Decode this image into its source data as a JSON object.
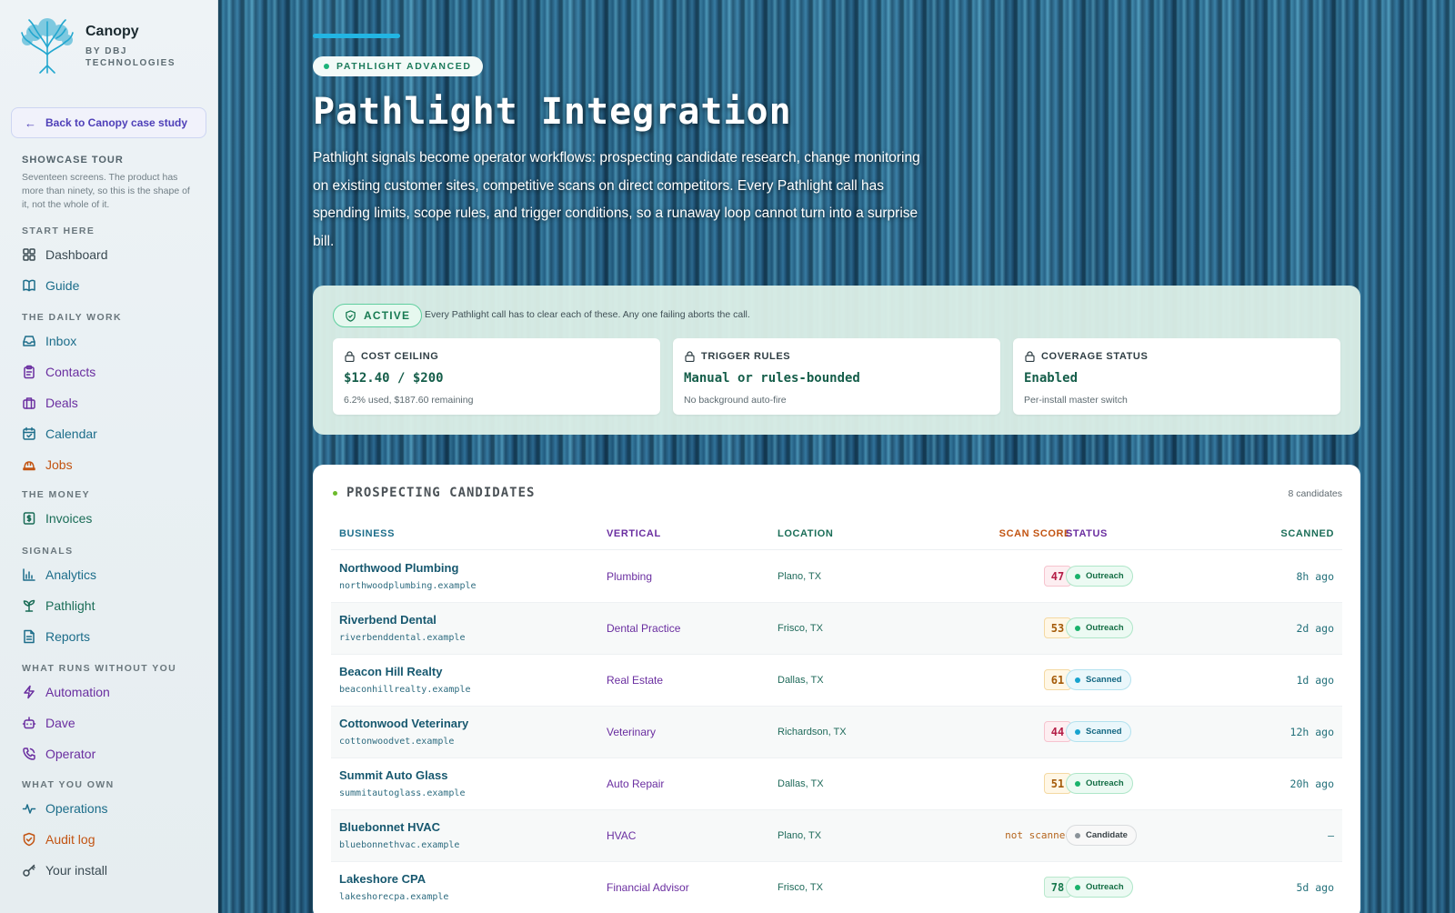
{
  "brand": {
    "name": "Canopy",
    "sub": "BY DBJ TECHNOLOGIES"
  },
  "sidebar": {
    "back_label": "Back to Canopy case study",
    "tour_title": "SHOWCASE TOUR",
    "tour_desc": "Seventeen screens. The product has more than ninety, so this is the shape of it, not the whole of it.",
    "sections": [
      {
        "title": "START HERE",
        "items": [
          {
            "label": "Dashboard",
            "icon": "grid-icon",
            "color": "#3a4a52"
          },
          {
            "label": "Guide",
            "icon": "book-icon",
            "color": "#1c6d8a"
          }
        ]
      },
      {
        "title": "THE DAILY WORK",
        "items": [
          {
            "label": "Inbox",
            "icon": "inbox-icon",
            "color": "#1c6d8a"
          },
          {
            "label": "Contacts",
            "icon": "clipboard-icon",
            "color": "#6a2ea0"
          },
          {
            "label": "Deals",
            "icon": "briefcase-icon",
            "color": "#6a2ea0"
          },
          {
            "label": "Calendar",
            "icon": "calendar-icon",
            "color": "#1c6d8a"
          },
          {
            "label": "Jobs",
            "icon": "hardhat-icon",
            "color": "#c25412"
          }
        ]
      },
      {
        "title": "THE MONEY",
        "items": [
          {
            "label": "Invoices",
            "icon": "invoice-icon",
            "color": "#1a6d57"
          }
        ]
      },
      {
        "title": "SIGNALS",
        "items": [
          {
            "label": "Analytics",
            "icon": "bar-chart-icon",
            "color": "#1c6d8a"
          },
          {
            "label": "Pathlight",
            "icon": "sprout-icon",
            "color": "#1a6d57"
          },
          {
            "label": "Reports",
            "icon": "document-icon",
            "color": "#1c6d8a"
          }
        ]
      },
      {
        "title": "WHAT RUNS WITHOUT YOU",
        "items": [
          {
            "label": "Automation",
            "icon": "bolt-icon",
            "color": "#6a2ea0"
          },
          {
            "label": "Dave",
            "icon": "robot-icon",
            "color": "#6a2ea0"
          },
          {
            "label": "Operator",
            "icon": "phone-icon",
            "color": "#6a2ea0"
          }
        ]
      },
      {
        "title": "WHAT YOU OWN",
        "items": [
          {
            "label": "Operations",
            "icon": "pulse-icon",
            "color": "#1c6d8a"
          },
          {
            "label": "Audit log",
            "icon": "shield-icon",
            "color": "#c25412"
          },
          {
            "label": "Your install",
            "icon": "key-icon",
            "color": "#3a4a52"
          }
        ]
      }
    ]
  },
  "hero": {
    "pill": "PATHLIGHT ADVANCED",
    "title": "Pathlight Integration",
    "description": "Pathlight signals become operator workflows: prospecting candidate research, change monitoring on existing customer sites, competitive scans on direct competitors. Every Pathlight call has spending limits, scope rules, and trigger conditions, so a runaway loop cannot turn into a surprise bill."
  },
  "guard": {
    "status": "ACTIVE",
    "note": "Every Pathlight call has to clear each of these. Any one failing aborts the call.",
    "cards": [
      {
        "label": "COST CEILING",
        "value": "$12.40 / $200",
        "sub": "6.2% used, $187.60 remaining"
      },
      {
        "label": "TRIGGER RULES",
        "value": "Manual or rules-bounded",
        "sub": "No background auto-fire"
      },
      {
        "label": "COVERAGE STATUS",
        "value": "Enabled",
        "sub": "Per-install master switch"
      }
    ]
  },
  "candidates": {
    "title": "PROSPECTING CANDIDATES",
    "count": "8 candidates",
    "headers": {
      "business": "BUSINESS",
      "vertical": "VERTICAL",
      "location": "LOCATION",
      "score": "SCAN SCORE",
      "status": "STATUS",
      "scanned": "SCANNED"
    },
    "header_colors": {
      "business": "#1c6d8a",
      "vertical": "#6a2ea0",
      "location": "#1a6d57",
      "score": "#c25412",
      "status": "#6a2ea0",
      "scanned": "#1a6d57"
    },
    "rows": [
      {
        "business": "Northwood Plumbing",
        "domain": "northwoodplumbing.example",
        "vertical": "Plumbing",
        "location": "Plano, TX",
        "score": "47",
        "score_level": "red",
        "status": "Outreach",
        "status_kind": "outreach",
        "scanned": "8h ago"
      },
      {
        "business": "Riverbend Dental",
        "domain": "riverbenddental.example",
        "vertical": "Dental Practice",
        "location": "Frisco, TX",
        "score": "53",
        "score_level": "amber",
        "status": "Outreach",
        "status_kind": "outreach",
        "scanned": "2d ago"
      },
      {
        "business": "Beacon Hill Realty",
        "domain": "beaconhillrealty.example",
        "vertical": "Real Estate",
        "location": "Dallas, TX",
        "score": "61",
        "score_level": "amber",
        "status": "Scanned",
        "status_kind": "scanned",
        "scanned": "1d ago"
      },
      {
        "business": "Cottonwood Veterinary",
        "domain": "cottonwoodvet.example",
        "vertical": "Veterinary",
        "location": "Richardson, TX",
        "score": "44",
        "score_level": "red",
        "status": "Scanned",
        "status_kind": "scanned",
        "scanned": "12h ago"
      },
      {
        "business": "Summit Auto Glass",
        "domain": "summitautoglass.example",
        "vertical": "Auto Repair",
        "location": "Dallas, TX",
        "score": "51",
        "score_level": "amber",
        "status": "Outreach",
        "status_kind": "outreach",
        "scanned": "20h ago"
      },
      {
        "business": "Bluebonnet HVAC",
        "domain": "bluebonnethvac.example",
        "vertical": "HVAC",
        "location": "Plano, TX",
        "score": "not scanned",
        "score_level": "none",
        "status": "Candidate",
        "status_kind": "candidate",
        "scanned": "–"
      },
      {
        "business": "Lakeshore CPA",
        "domain": "lakeshorecpa.example",
        "vertical": "Financial Advisor",
        "location": "Frisco, TX",
        "score": "78",
        "score_level": "green",
        "status": "Outreach",
        "status_kind": "outreach",
        "scanned": "5d ago"
      }
    ]
  }
}
